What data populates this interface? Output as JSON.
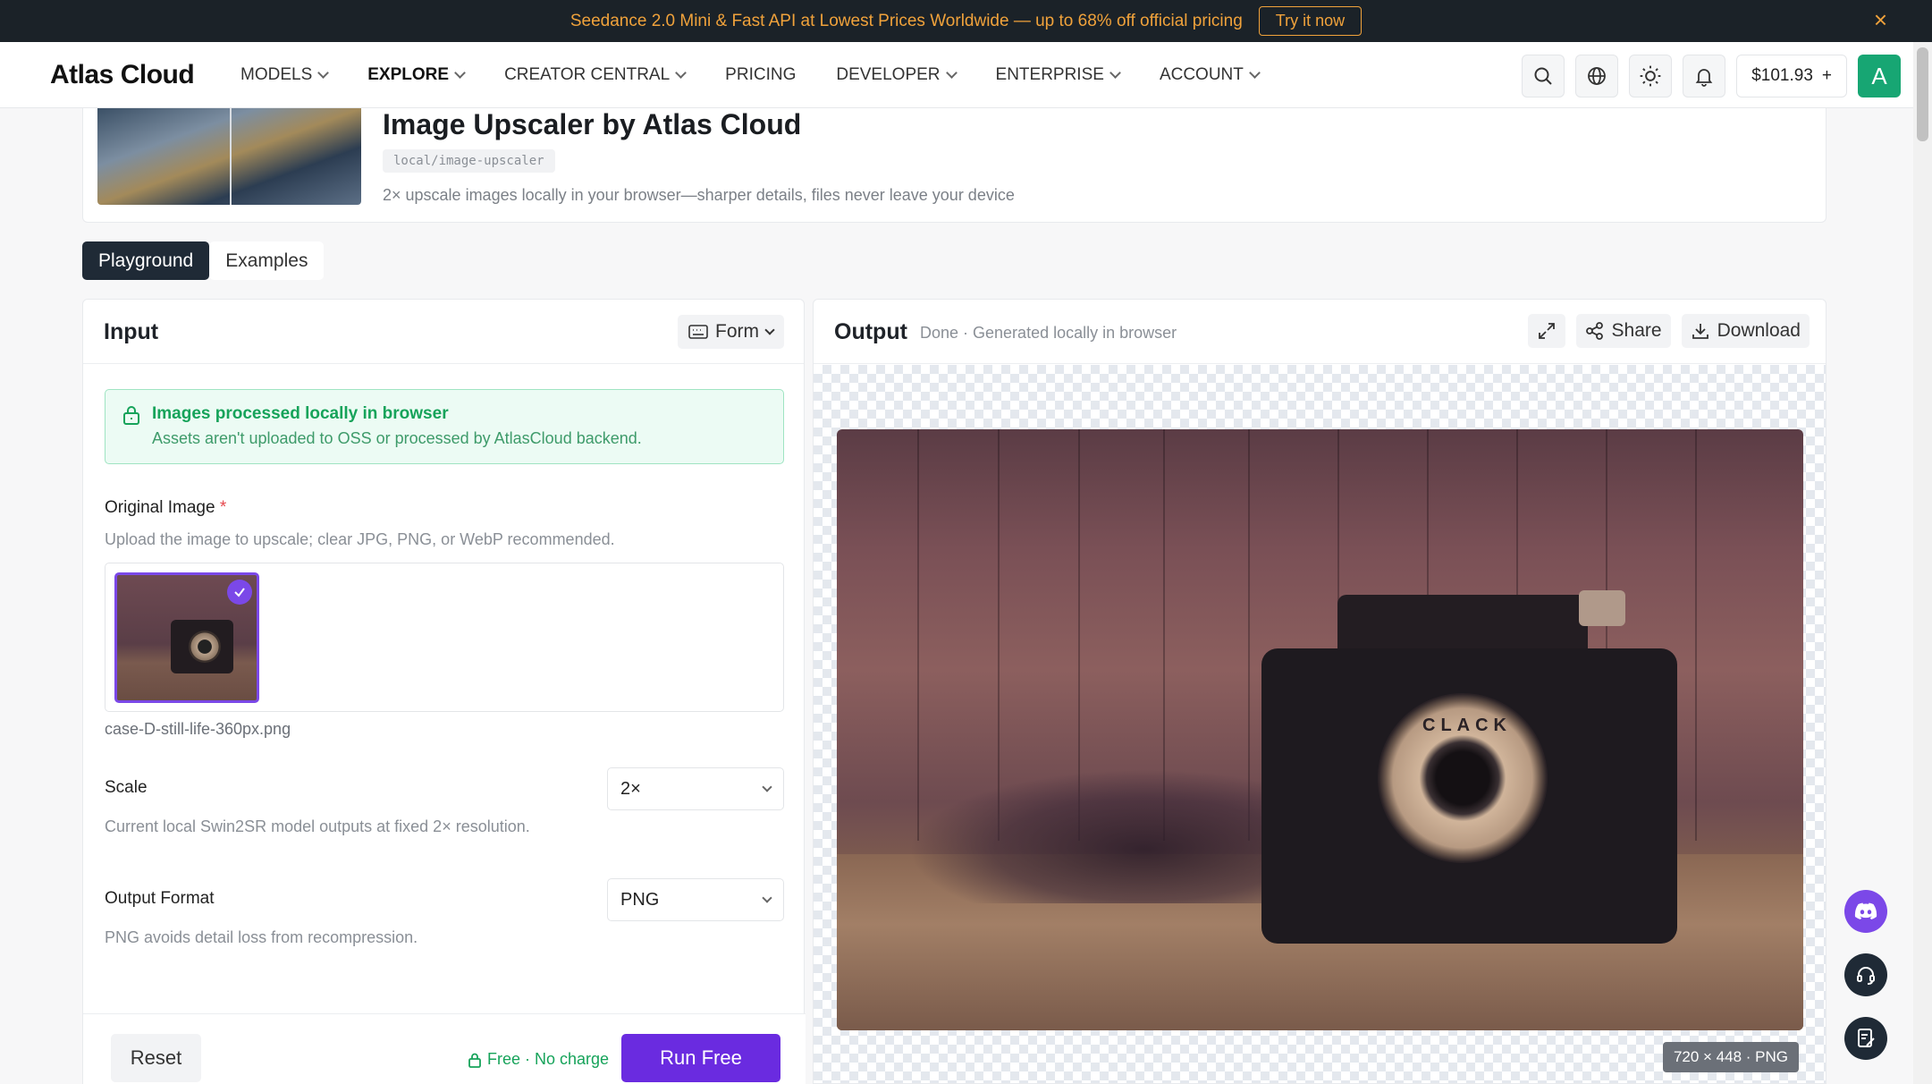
{
  "promo": {
    "text": "Seedance 2.0 Mini & Fast API at Lowest Prices Worldwide — up to 68% off official pricing",
    "button": "Try it now",
    "close": "×"
  },
  "nav": {
    "logo": "Atlas Cloud",
    "items": [
      {
        "label": "MODELS",
        "dropdown": true
      },
      {
        "label": "EXPLORE",
        "dropdown": true,
        "active": true
      },
      {
        "label": "CREATOR CENTRAL",
        "dropdown": true
      },
      {
        "label": "PRICING",
        "dropdown": false
      },
      {
        "label": "DEVELOPER",
        "dropdown": true
      },
      {
        "label": "ENTERPRISE",
        "dropdown": true
      },
      {
        "label": "ACCOUNT",
        "dropdown": true
      }
    ],
    "balance": "$101.93",
    "balance_plus": "+",
    "avatar_initial": "A"
  },
  "header": {
    "title": "Image Upscaler by Atlas Cloud",
    "slug": "local/image-upscaler",
    "subtitle": "2× upscale images locally in your browser—sharper details, files never leave your device"
  },
  "tabs": [
    {
      "label": "Playground",
      "active": true
    },
    {
      "label": "Examples",
      "active": false
    }
  ],
  "input": {
    "title": "Input",
    "mode": "Form",
    "notice_title": "Images processed locally in browser",
    "notice_desc": "Assets aren't uploaded to OSS or processed by AtlasCloud backend.",
    "original_image_label": "Original Image",
    "required_mark": "*",
    "original_image_hint": "Upload the image to upscale; clear JPG, PNG, or WebP recommended.",
    "filename": "case-D-still-life-360px.png",
    "scale_label": "Scale",
    "scale_value": "2×",
    "scale_hint": "Current local Swin2SR model outputs at fixed 2× resolution.",
    "format_label": "Output Format",
    "format_value": "PNG",
    "format_hint": "PNG avoids detail loss from recompression.",
    "reset": "Reset",
    "free_note": "Free · No charge",
    "run": "Run Free"
  },
  "output": {
    "title": "Output",
    "status": "Done · Generated locally in browser",
    "share": "Share",
    "download": "Download",
    "dimensions": "720 × 448 · PNG",
    "camera_text": "CLACK"
  },
  "colors": {
    "accent": "#6a2be0",
    "promo_text": "#f0a23b",
    "success": "#16a35a",
    "dark": "#1f2a36"
  },
  "icons": [
    "search-icon",
    "globe-icon",
    "sun-icon",
    "bell-icon",
    "lock-icon",
    "check-icon",
    "expand-icon",
    "share-icon",
    "download-icon",
    "discord-icon",
    "headset-icon",
    "feedback-icon"
  ]
}
